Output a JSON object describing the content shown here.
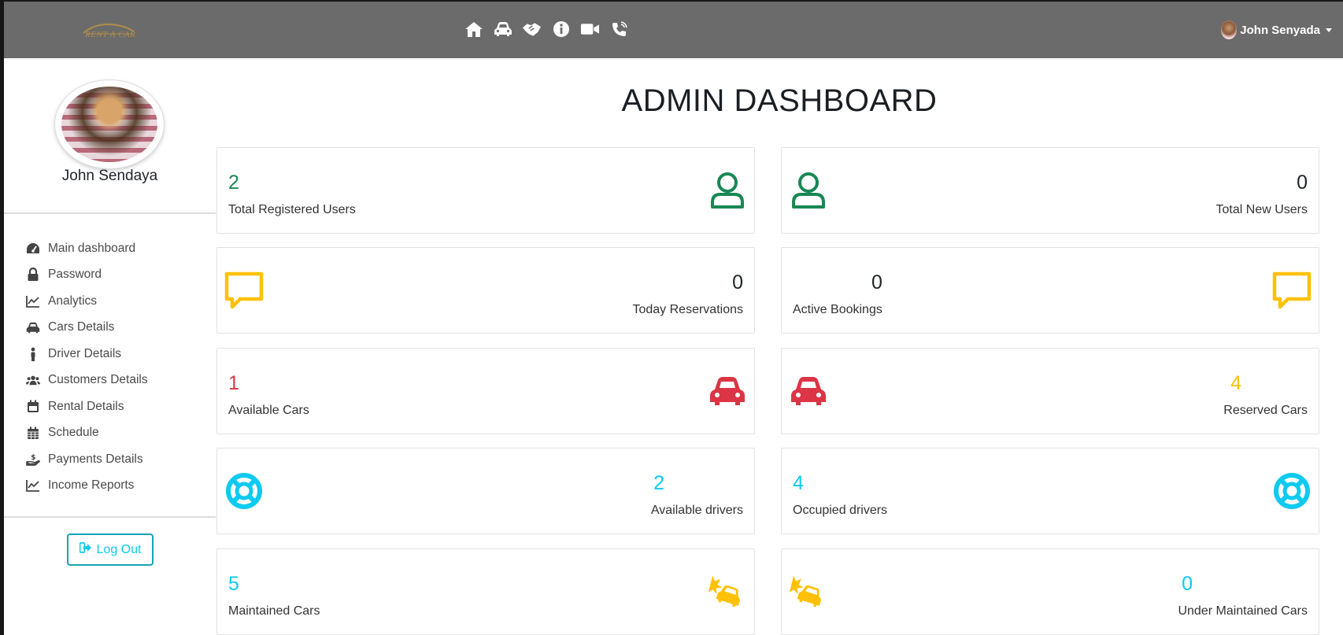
{
  "navbar": {
    "brand_text": "RENT A CAR",
    "icons": [
      "home-icon",
      "car-icon",
      "handshake-icon",
      "info-icon",
      "video-icon",
      "phone-icon"
    ],
    "user_name": "John Senyada"
  },
  "sidebar": {
    "profile_name": "John Sendaya",
    "items": [
      {
        "label": "Main dashboard",
        "icon": "tachometer-icon"
      },
      {
        "label": "Password",
        "icon": "lock-icon"
      },
      {
        "label": "Analytics",
        "icon": "line-chart-icon"
      },
      {
        "label": "Cars Details",
        "icon": "car-icon"
      },
      {
        "label": "Driver Details",
        "icon": "person-icon"
      },
      {
        "label": "Customers Details",
        "icon": "users-icon"
      },
      {
        "label": "Rental Details",
        "icon": "calendar-icon"
      },
      {
        "label": "Schedule",
        "icon": "calendar-grid-icon"
      },
      {
        "label": "Payments Details",
        "icon": "hand-dollar-icon"
      },
      {
        "label": "Income Reports",
        "icon": "line-chart-icon"
      }
    ],
    "logout_label": "Log Out"
  },
  "main": {
    "title": "ADMIN DASHBOARD",
    "cards": [
      {
        "value": "2",
        "label": "Total Registered Users"
      },
      {
        "value": "0",
        "label": "Total New Users"
      },
      {
        "value": "0",
        "label": "Today Reservations"
      },
      {
        "value": "0",
        "label": "Active Bookings"
      },
      {
        "value": "1",
        "label": "Available Cars"
      },
      {
        "value": "4",
        "label": "Reserved Cars"
      },
      {
        "value": "2",
        "label": "Available drivers"
      },
      {
        "value": "4",
        "label": "Occupied drivers"
      },
      {
        "value": "5",
        "label": "Maintained Cars"
      },
      {
        "value": "0",
        "label": "Under Maintained Cars"
      }
    ]
  },
  "colors": {
    "green": "#198754",
    "yellow": "#ffc107",
    "red": "#dc3545",
    "cyan": "#0dcaf0",
    "navbar": "#6b6b6b"
  }
}
